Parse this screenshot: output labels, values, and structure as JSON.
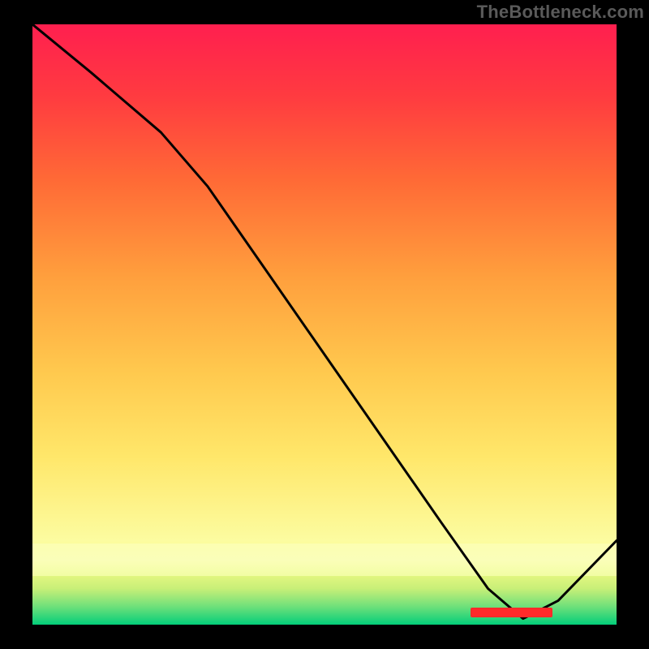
{
  "watermark": "TheBottleneck.com",
  "redbar_label": "",
  "chart_data": {
    "type": "line",
    "title": "",
    "xlabel": "",
    "ylabel": "",
    "xlim": [
      0,
      100
    ],
    "ylim": [
      0,
      100
    ],
    "grid": false,
    "legend": false,
    "background": "heat-gradient (green bottom → yellow mid → red top)",
    "series": [
      {
        "name": "curve",
        "x": [
          0,
          10,
          22,
          30,
          40,
          50,
          60,
          70,
          78,
          84,
          90,
          100
        ],
        "y": [
          100,
          92,
          82,
          73,
          59,
          45,
          31,
          17,
          6,
          1,
          4,
          14
        ]
      }
    ],
    "annotations": [
      {
        "name": "red-bar",
        "x": 82,
        "y": 2,
        "width_pct": 14,
        "text": ""
      }
    ]
  }
}
